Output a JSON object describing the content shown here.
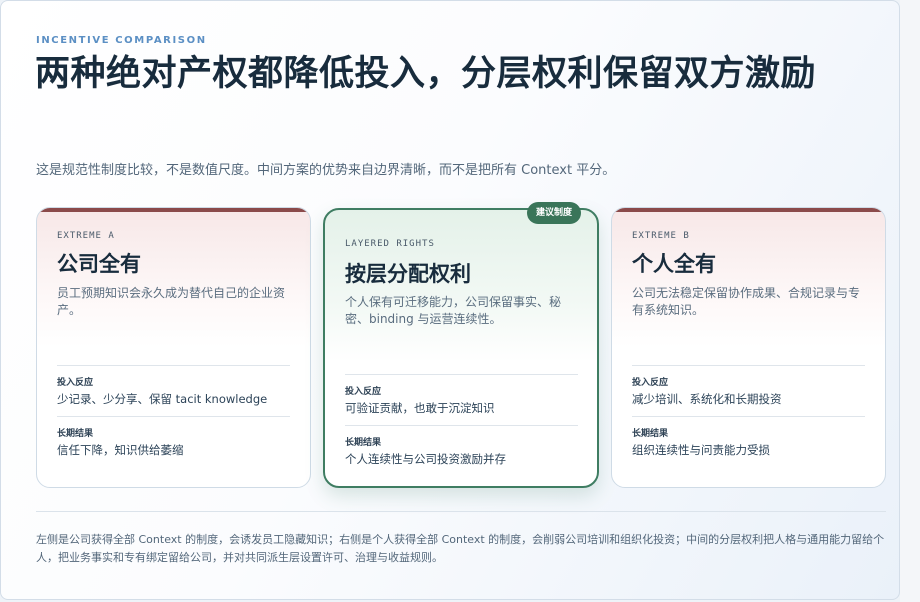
{
  "header": {
    "eyebrow": "INCENTIVE COMPARISON",
    "title": "两种绝对产权都降低投入，分层权利保留双方激励",
    "subtitle": "这是规范性制度比较，不是数值尺度。中间方案的优势来自边界清晰，而不是把所有 Context 平分。"
  },
  "cards": {
    "left": {
      "label": "EXTREME A",
      "title": "公司全有",
      "description": "员工预期知识会永久成为替代自己的企业资产。",
      "input_label": "投入反应",
      "input_value": "少记录、少分享、保留 tacit knowledge",
      "outcome_label": "长期结果",
      "outcome_value": "信任下降，知识供给萎缩"
    },
    "middle": {
      "badge": "建议制度",
      "label": "LAYERED RIGHTS",
      "title": "按层分配权利",
      "description": "个人保有可迁移能力，公司保留事实、秘密、binding 与运营连续性。",
      "input_label": "投入反应",
      "input_value": "可验证贡献，也敢于沉淀知识",
      "outcome_label": "长期结果",
      "outcome_value": "个人连续性与公司投资激励并存"
    },
    "right": {
      "label": "EXTREME B",
      "title": "个人全有",
      "description": "公司无法稳定保留协作成果、合规记录与专有系统知识。",
      "input_label": "投入反应",
      "input_value": "减少培训、系统化和长期投资",
      "outcome_label": "长期结果",
      "outcome_value": "组织连续性与问责能力受损"
    }
  },
  "footnote": "左侧是公司获得全部 Context 的制度，会诱发员工隐藏知识；右侧是个人获得全部 Context 的制度，会削弱公司培训和组织化投资；中间的分层权利把人格与通用能力留给个人，把业务事实和专有绑定留给公司，并对共同派生层设置许可、治理与收益规则。",
  "colors": {
    "accent_green": "#3a7559",
    "accent_red": "#8b4a4a",
    "eyebrow_blue": "#5b8fc4",
    "heading": "#182c3d"
  }
}
